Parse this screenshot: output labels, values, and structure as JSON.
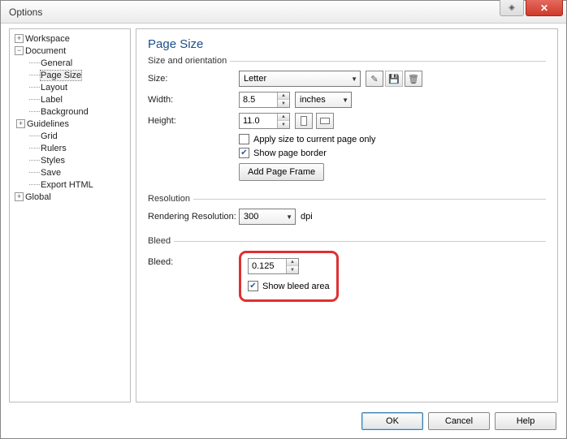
{
  "window": {
    "title": "Options"
  },
  "tree": {
    "workspace": "Workspace",
    "document": "Document",
    "general": "General",
    "pagesize": "Page Size",
    "layout": "Layout",
    "label": "Label",
    "background": "Background",
    "guidelines": "Guidelines",
    "grid": "Grid",
    "rulers": "Rulers",
    "styles": "Styles",
    "save": "Save",
    "exporthtml": "Export HTML",
    "global": "Global"
  },
  "page": {
    "title": "Page Size",
    "sizeorient_legend": "Size and orientation",
    "size_label": "Size:",
    "size_value": "Letter",
    "width_label": "Width:",
    "width_value": "8.5",
    "units_value": "inches",
    "height_label": "Height:",
    "height_value": "11.0",
    "apply_current": "Apply size to current page only",
    "show_border": "Show page border",
    "add_frame": "Add Page Frame",
    "resolution_legend": "Resolution",
    "render_res_label": "Rendering Resolution:",
    "render_res_value": "300",
    "dpi": "dpi",
    "bleed_legend": "Bleed",
    "bleed_label": "Bleed:",
    "bleed_value": "0.125",
    "show_bleed": "Show bleed area"
  },
  "buttons": {
    "ok": "OK",
    "cancel": "Cancel",
    "help": "Help"
  }
}
